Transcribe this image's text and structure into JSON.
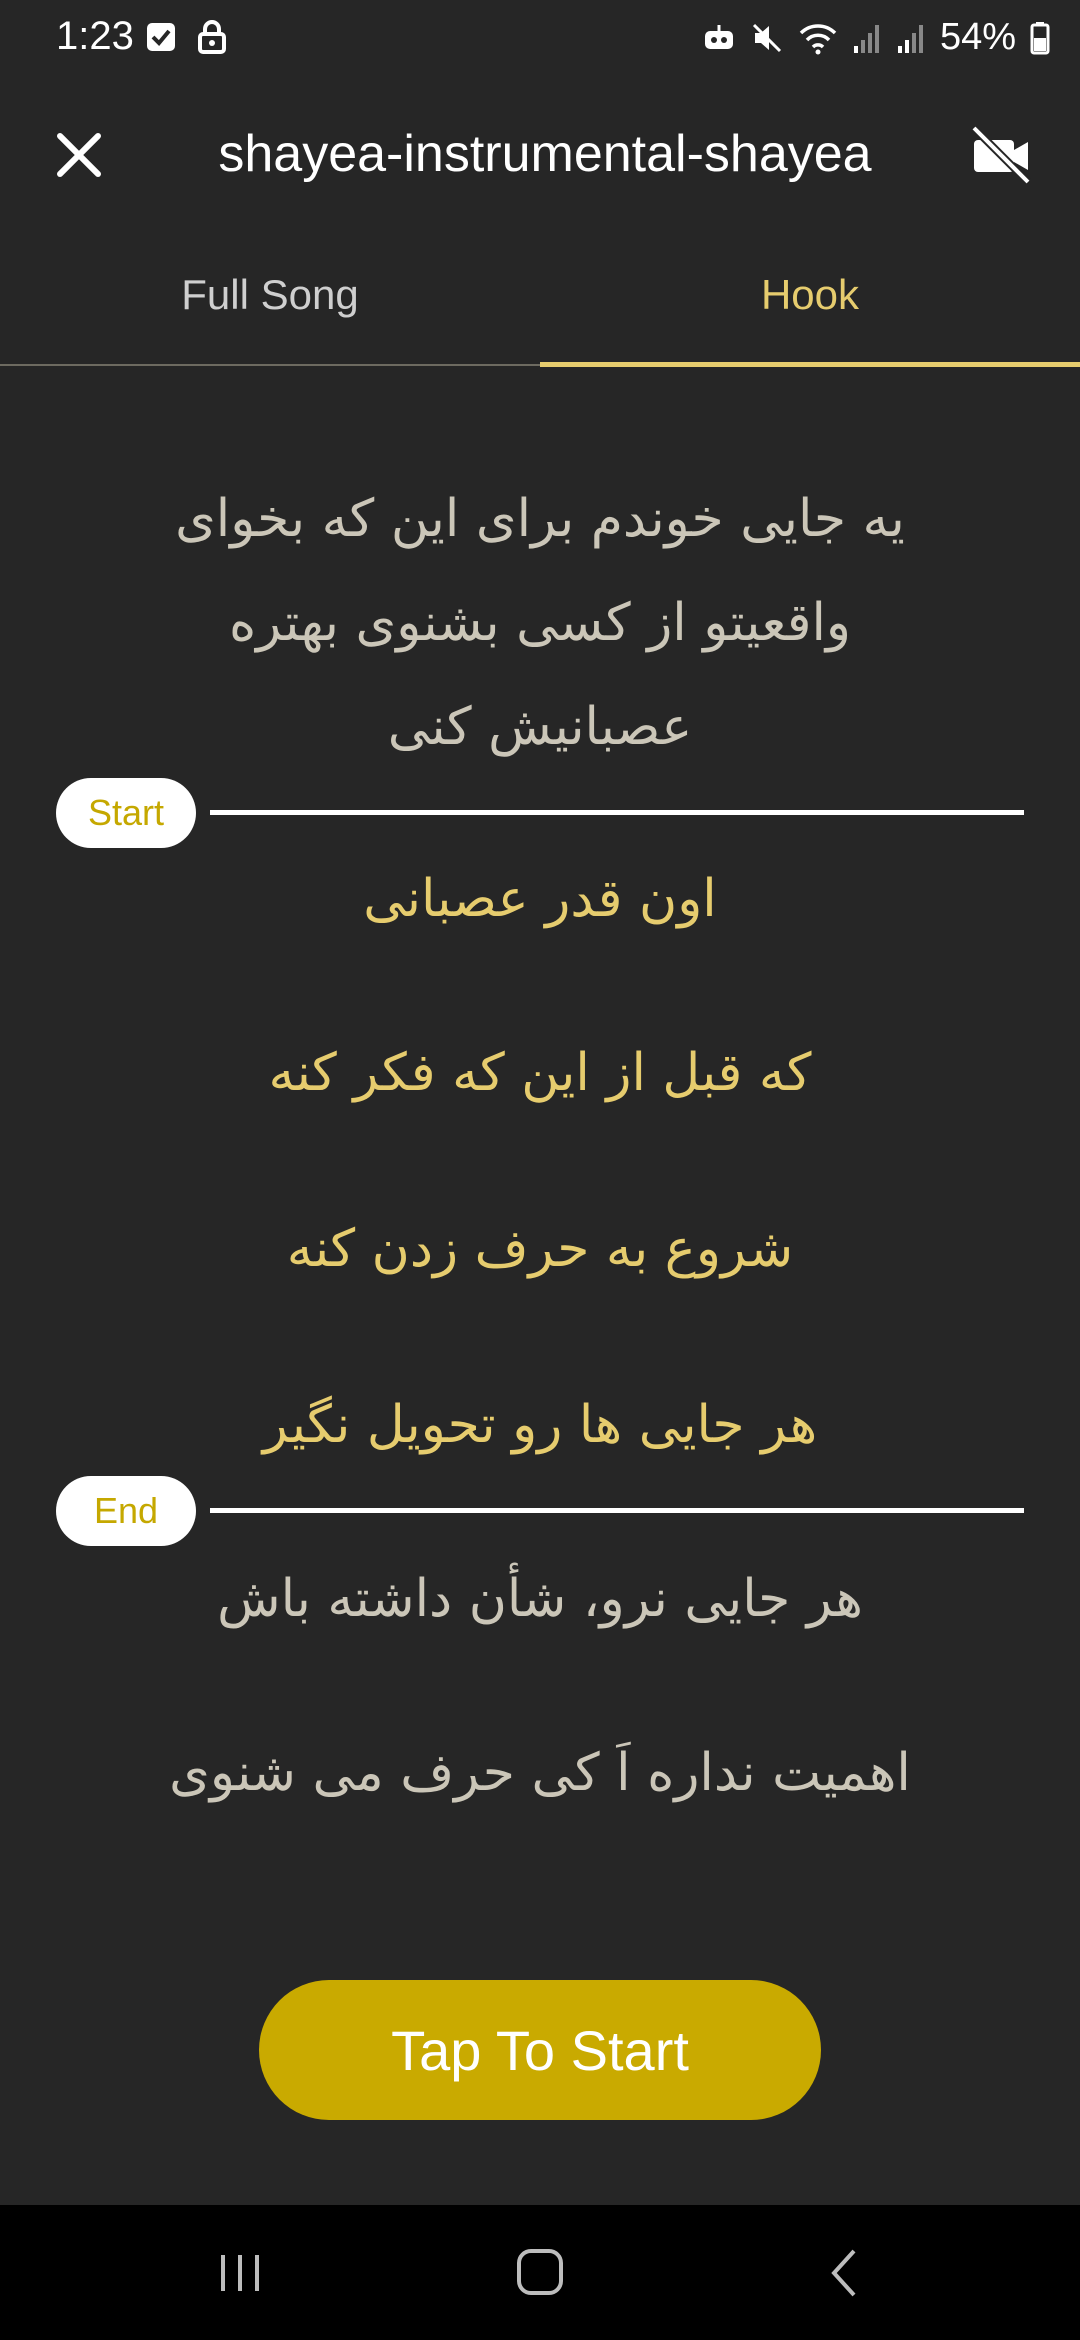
{
  "status_bar": {
    "time": "1:23",
    "battery_percent": "54%"
  },
  "header": {
    "title": "shayea-instrumental-shayea"
  },
  "tabs": [
    {
      "label": "Full Song",
      "active": false
    },
    {
      "label": "Hook",
      "active": true
    }
  ],
  "lyrics": {
    "before": [
      "یه جایی خوندم برای این که بخوای",
      "واقعیتو از کسی بشنوی بهتره",
      "عصبانیش کنی"
    ],
    "hook": [
      "اون قدر عصبانی",
      "که قبل از این که فکر کنه",
      "شروع به حرف زدن کنه",
      "هر جایی ها رو تحویل نگیر"
    ],
    "after": [
      "هر جایی نرو، شأن داشته باش",
      "اهمیت نداره اَ کی حرف می شنوی"
    ]
  },
  "markers": {
    "start_label": "Start",
    "end_label": "End"
  },
  "action": {
    "start_button": "Tap To Start"
  },
  "colors": {
    "accent": "#e6cc6e",
    "button": "#c9aa00",
    "background": "#262626"
  }
}
